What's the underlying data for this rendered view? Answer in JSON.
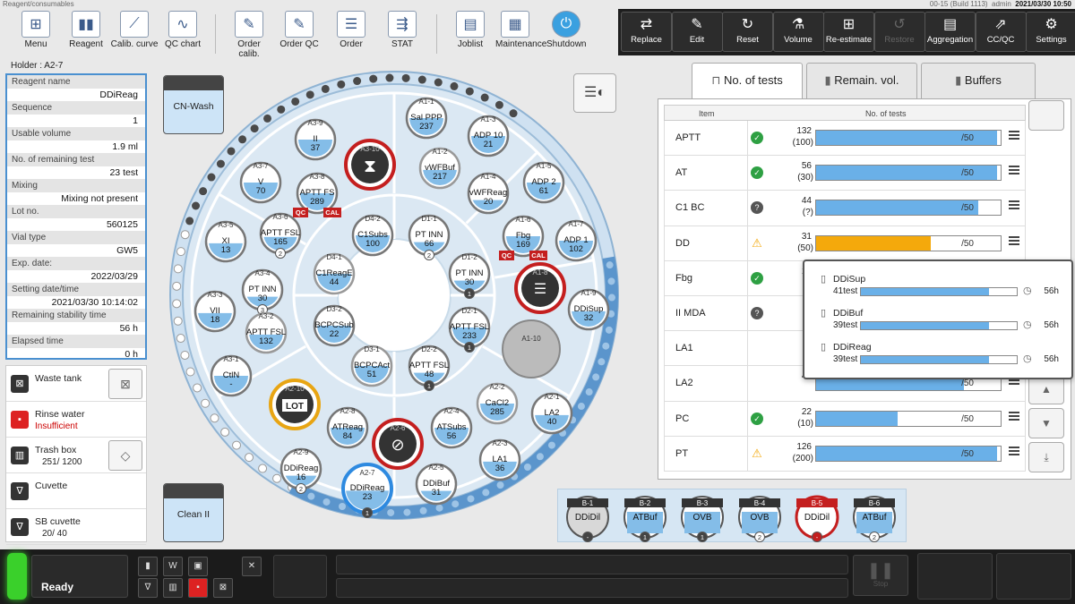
{
  "window": {
    "title": "Reagent/consumables",
    "build": "00-15 (Build 1113)",
    "user": "admin",
    "datetime": "2021/03/30 10:50"
  },
  "toolbar": [
    {
      "label": "Menu",
      "icon": "menu-grid-icon"
    },
    {
      "label": "Reagent",
      "icon": "reagent-bottles-icon"
    },
    {
      "label": "Calib. curve",
      "icon": "calib-curve-icon"
    },
    {
      "label": "QC chart",
      "icon": "qc-chart-icon"
    },
    {
      "label": "Order calib.",
      "icon": "order-calib-icon"
    },
    {
      "label": "Order QC",
      "icon": "order-qc-icon"
    },
    {
      "label": "Order",
      "icon": "order-icon"
    },
    {
      "label": "STAT",
      "icon": "stat-icon"
    },
    {
      "label": "Joblist",
      "icon": "joblist-icon"
    },
    {
      "label": "Maintenance",
      "icon": "maintenance-icon"
    },
    {
      "label": "Shutdown",
      "icon": "shutdown-icon"
    }
  ],
  "dark_toolbar": [
    {
      "label": "Replace",
      "icon": "replace-icon",
      "enabled": true
    },
    {
      "label": "Edit",
      "icon": "edit-icon",
      "enabled": true
    },
    {
      "label": "Reset",
      "icon": "reset-icon",
      "enabled": true
    },
    {
      "label": "Volume",
      "icon": "volume-icon",
      "enabled": true
    },
    {
      "label": "Re-estimate",
      "icon": "reestimate-icon",
      "enabled": true
    },
    {
      "label": "Restore",
      "icon": "restore-icon",
      "enabled": false
    },
    {
      "label": "Aggregation",
      "icon": "aggregation-icon",
      "enabled": true
    },
    {
      "label": "CC/QC",
      "icon": "ccqc-icon",
      "enabled": true
    },
    {
      "label": "Settings",
      "icon": "settings-icon",
      "enabled": true
    }
  ],
  "holder": {
    "label": "Holder : A2-7"
  },
  "info": [
    {
      "key": "Reagent name",
      "value": "DDiReag"
    },
    {
      "key": "Sequence",
      "value": "1"
    },
    {
      "key": "Usable volume",
      "value": "1.9 ml"
    },
    {
      "key": "No. of remaining test",
      "value": "23 test"
    },
    {
      "key": "Mixing",
      "value": "Mixing not present"
    },
    {
      "key": "Lot no.",
      "value": "560125"
    },
    {
      "key": "Vial type",
      "value": "GW5"
    },
    {
      "key": "Exp. date:",
      "value": "2022/03/29"
    },
    {
      "key": "Setting date/time",
      "value": "2021/03/30 10:14:02"
    },
    {
      "key": "Remaining stability time",
      "value": "56 h"
    },
    {
      "key": "Elapsed time",
      "value": "0 h"
    }
  ],
  "status": [
    {
      "label": "Waste tank",
      "value": "",
      "alert": false
    },
    {
      "label": "Rinse water",
      "value": "Insufficient",
      "alert": true
    },
    {
      "label": "Trash box",
      "value": "251/  1200",
      "alert": false
    },
    {
      "label": "Cuvette",
      "value": "",
      "alert": false
    },
    {
      "label": "SB cuvette",
      "value": "20/  40",
      "alert": false
    }
  ],
  "side_containers": {
    "top": "CN-Wash",
    "bottom": "Clean II"
  },
  "vials": [
    {
      "id": "A1-1",
      "name": "Sal PPP",
      "count": "237",
      "ring": "o",
      "fill": 0.5
    },
    {
      "id": "A1-3",
      "name": "ADP 10",
      "count": "21",
      "ring": "o",
      "fill": 0.5
    },
    {
      "id": "A1-2",
      "name": "vWFBuf",
      "count": "217",
      "ring": "g",
      "fill": 0.45
    },
    {
      "id": "A1-4",
      "name": "vWFReag",
      "count": "20",
      "ring": "o",
      "fill": 0.3
    },
    {
      "id": "A1-5",
      "name": "ADP 2",
      "count": "61",
      "ring": "o",
      "fill": 0.5
    },
    {
      "id": "A1-6",
      "name": "Fbg",
      "count": "169",
      "ring": "o",
      "fill": 0.5,
      "qc": "QC",
      "cal": "CAL"
    },
    {
      "id": "A1-7",
      "name": "ADP 1",
      "count": "102",
      "ring": "o",
      "fill": 0.5
    },
    {
      "id": "A1-8",
      "name": "",
      "count": "",
      "ring": "r",
      "fill": 0,
      "warn": true
    },
    {
      "id": "A1-9",
      "name": "DDiSup",
      "count": "32",
      "ring": "o",
      "fill": 0.45
    },
    {
      "id": "A1-10",
      "name": "",
      "count": "",
      "ring": "e",
      "fill": 0
    },
    {
      "id": "A3-9",
      "name": "II",
      "count": "37",
      "ring": "o",
      "fill": 0.5
    },
    {
      "id": "A3-10",
      "name": "",
      "count": "",
      "ring": "r",
      "fill": 0,
      "hourglass": true
    },
    {
      "id": "A3-7",
      "name": "V",
      "count": "70",
      "ring": "o",
      "fill": 0.5
    },
    {
      "id": "A3-8",
      "name": "APTT FS",
      "count": "289",
      "ring": "o",
      "fill": 0.5,
      "qc": "QC",
      "cal": "CAL"
    },
    {
      "id": "A3-5",
      "name": "XI",
      "count": "13",
      "ring": "o",
      "fill": 0.45
    },
    {
      "id": "A3-6",
      "name": "APTT FSL",
      "count": "165",
      "ring": "o",
      "fill": 0.4,
      "badge": "2"
    },
    {
      "id": "A3-4",
      "name": "PT INN",
      "count": "30",
      "ring": "o",
      "fill": 0.3,
      "badge": "3"
    },
    {
      "id": "A3-3",
      "name": "VII",
      "count": "18",
      "ring": "o",
      "fill": 0.45
    },
    {
      "id": "A3-2",
      "name": "APTT FSL",
      "count": "132",
      "ring": "g",
      "fill": 0.45
    },
    {
      "id": "A3-1",
      "name": "CtlN",
      "count": "-",
      "ring": "o",
      "fill": 0.5
    },
    {
      "id": "A2-10",
      "name": "",
      "count": "",
      "ring": "y",
      "fill": 0,
      "lot": true
    },
    {
      "id": "A2-8",
      "name": "ATReag",
      "count": "84",
      "ring": "o",
      "fill": 0.5
    },
    {
      "id": "A2-9",
      "name": "DDiReag",
      "count": "16",
      "ring": "o",
      "fill": 0.3,
      "badge": "2"
    },
    {
      "id": "A2-6",
      "name": "",
      "count": "",
      "ring": "r",
      "fill": 0,
      "noentry": true
    },
    {
      "id": "A2-4",
      "name": "ATSubs",
      "count": "56",
      "ring": "o",
      "fill": 0.5
    },
    {
      "id": "A2-7",
      "name": "DDiReag",
      "count": "23",
      "ring": "b",
      "fill": 0.45,
      "badge": "1"
    },
    {
      "id": "A2-5",
      "name": "DDiBuf",
      "count": "31",
      "ring": "o",
      "fill": 0.3
    },
    {
      "id": "A2-3",
      "name": "LA1",
      "count": "36",
      "ring": "o",
      "fill": 0.45
    },
    {
      "id": "A2-2",
      "name": "CaCl2",
      "count": "285",
      "ring": "g",
      "fill": 0.5
    },
    {
      "id": "A2-1",
      "name": "LA2",
      "count": "40",
      "ring": "o",
      "fill": 0.45
    },
    {
      "id": "D4-2",
      "name": "C1Subs",
      "count": "100",
      "ring": "o",
      "fill": 0.5
    },
    {
      "id": "D4-1",
      "name": "C1ReagE",
      "count": "44",
      "ring": "g",
      "fill": 0.5
    },
    {
      "id": "D3-2",
      "name": "BCPCSub",
      "count": "22",
      "ring": "o",
      "fill": 0.5
    },
    {
      "id": "D3-1",
      "name": "BCPCAct",
      "count": "51",
      "ring": "g",
      "fill": 0.5
    },
    {
      "id": "D2-2",
      "name": "APTT FSL",
      "count": "48",
      "ring": "o",
      "fill": 0.3,
      "badge": "1"
    },
    {
      "id": "D2-1",
      "name": "APTT FSL",
      "count": "233",
      "ring": "o",
      "fill": 0.5,
      "badge": "1"
    },
    {
      "id": "D1-2",
      "name": "PT INN",
      "count": "30",
      "ring": "o",
      "fill": 0.3,
      "badge": "1"
    },
    {
      "id": "D1-1",
      "name": "PT INN",
      "count": "66",
      "ring": "o",
      "fill": 0.3,
      "badge": "2"
    }
  ],
  "view_toggle_icon": "view-toggle-icon",
  "tabs": [
    {
      "label": "No. of tests",
      "icon": "test-tube-icon",
      "active": true
    },
    {
      "label": "Remain. vol.",
      "icon": "bottle-icon",
      "active": false
    },
    {
      "label": "Buffers",
      "icon": "buffer-bottle-icon",
      "active": false
    }
  ],
  "table": {
    "headers": {
      "item": "Item",
      "tests": "No. of tests"
    },
    "rows": [
      {
        "name": "APTT",
        "status": "ok",
        "n1": "132",
        "n2": "(100)",
        "fill": 0.98,
        "bar_label": "/50"
      },
      {
        "name": "AT",
        "status": "ok",
        "n1": "56",
        "n2": "(30)",
        "fill": 0.98,
        "bar_label": "/50"
      },
      {
        "name": "C1 BC",
        "status": "unknown",
        "n1": "44",
        "n2": "(?)",
        "fill": 0.88,
        "bar_label": "/50"
      },
      {
        "name": "DD",
        "status": "warn",
        "n1": "31",
        "n2": "(50)",
        "fill": 0.62,
        "bar_label": "/50"
      },
      {
        "name": "Fbg",
        "status": "ok",
        "n1": "15",
        "n2": "(8",
        "fill": 0.98,
        "bar_label": "/50"
      },
      {
        "name": "II MDA",
        "status": "unknown",
        "n1": "4",
        "n2": "",
        "fill": 0.98,
        "bar_label": "/50"
      },
      {
        "name": "LA1",
        "status": "none",
        "n1": "3",
        "n2": "",
        "fill": 0.98,
        "bar_label": "/50"
      },
      {
        "name": "LA2",
        "status": "none",
        "n1": "40",
        "n2": "",
        "fill": 0.8,
        "bar_label": "/50"
      },
      {
        "name": "PC",
        "status": "ok",
        "n1": "22",
        "n2": "(10)",
        "fill": 0.44,
        "bar_label": "/50"
      },
      {
        "name": "PT",
        "status": "warn",
        "n1": "126",
        "n2": "(200)",
        "fill": 0.98,
        "bar_label": "/50"
      }
    ]
  },
  "popup": [
    {
      "name": "DDiSup",
      "count": "41test",
      "fill": 0.82,
      "hours": "56h"
    },
    {
      "name": "DDiBuf",
      "count": "39test",
      "fill": 0.82,
      "hours": "56h"
    },
    {
      "name": "DDiReag",
      "count": "39test",
      "fill": 0.82,
      "hours": "56h"
    }
  ],
  "buffers": [
    {
      "id": "B-1",
      "name": "DDiDil",
      "badge": "-",
      "style": "grey"
    },
    {
      "id": "B-2",
      "name": "ATBuf",
      "badge": "1",
      "style": "blue"
    },
    {
      "id": "B-3",
      "name": "OVB",
      "badge": "1",
      "style": "blue"
    },
    {
      "id": "B-4",
      "name": "OVB",
      "badge": "2",
      "style": "blue"
    },
    {
      "id": "B-5",
      "name": "DDiDil",
      "badge": "-",
      "style": "red"
    },
    {
      "id": "B-6",
      "name": "ATBuf",
      "badge": "2",
      "style": "blue"
    }
  ],
  "footer": {
    "status": "Ready",
    "stop_label": "Stop"
  },
  "colors": {
    "accent_blue": "#4a90d0",
    "fill_blue": "#6ab0e8",
    "warn_orange": "#f4a90c",
    "alert_red": "#d22222",
    "ok_green": "#2ea043",
    "ready_green": "#3ad02b"
  }
}
